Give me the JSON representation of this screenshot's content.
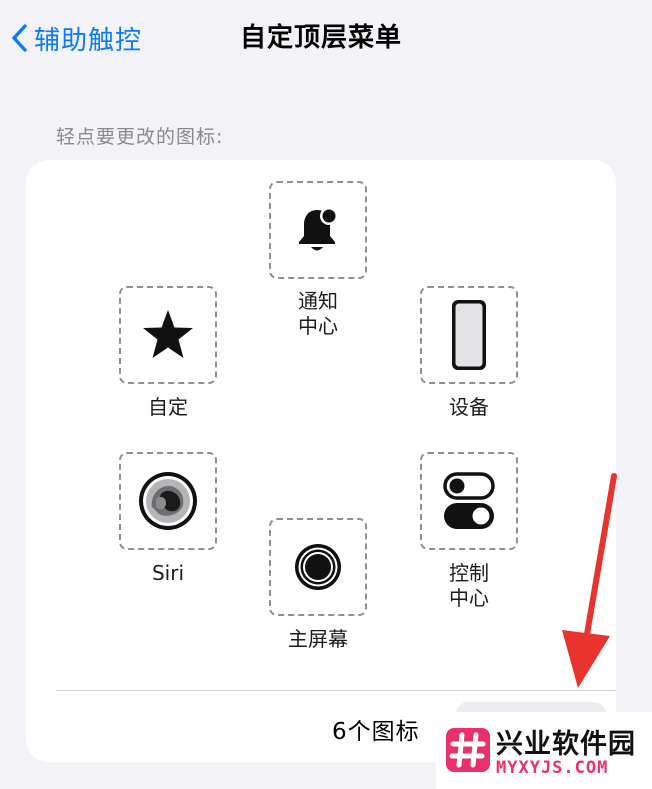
{
  "nav": {
    "back_label": "辅助触控",
    "title": "自定顶层菜单"
  },
  "hint": "轻点要更改的图标:",
  "menu_items": {
    "notification": {
      "label": "通知\n中心",
      "icon": "bell-badge-icon"
    },
    "custom": {
      "label": "自定",
      "icon": "star-icon"
    },
    "device": {
      "label": "设备",
      "icon": "iphone-icon"
    },
    "siri": {
      "label": "Siri",
      "icon": "siri-icon"
    },
    "control": {
      "label": "控制\n中心",
      "icon": "toggles-icon"
    },
    "home": {
      "label": "主屏幕",
      "icon": "home-button-icon"
    }
  },
  "footer": {
    "count_label": "6个图标"
  },
  "annotation": {
    "arrow_color": "#e8332f"
  },
  "watermark": {
    "name": "兴业软件园",
    "url": "MYXYJS.COM",
    "accent": "#e8316a"
  },
  "colors": {
    "accent": "#0a7aff",
    "background": "#f2f2f7",
    "card": "#ffffff"
  }
}
